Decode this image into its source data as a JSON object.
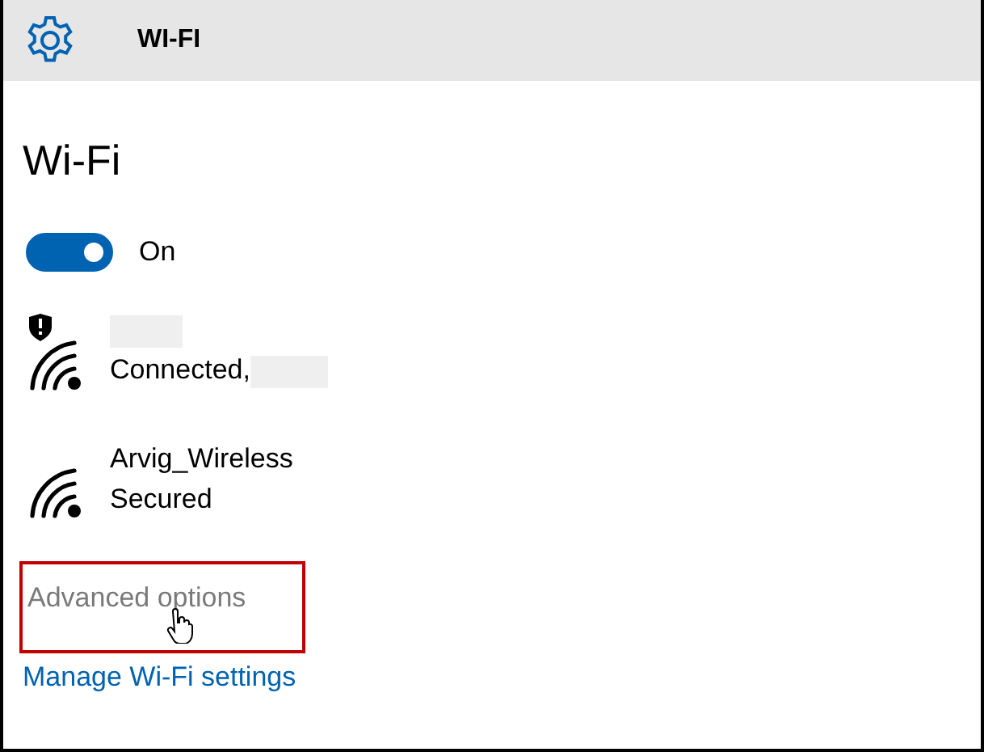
{
  "header": {
    "title": "WI-FI"
  },
  "page_title": "Wi-Fi",
  "wifi_toggle": {
    "on": true,
    "label": "On"
  },
  "networks": [
    {
      "name_redacted": true,
      "status": "Connected,",
      "status_redacted": true,
      "shield_warning": true
    },
    {
      "name": "Arvig_Wireless",
      "name_redacted": false,
      "status": "Secured",
      "status_redacted": false,
      "shield_warning": false
    }
  ],
  "advanced_options": {
    "label": "Advanced options",
    "disabled": true,
    "highlighted": true
  },
  "manage_link": "Manage Wi-Fi settings"
}
